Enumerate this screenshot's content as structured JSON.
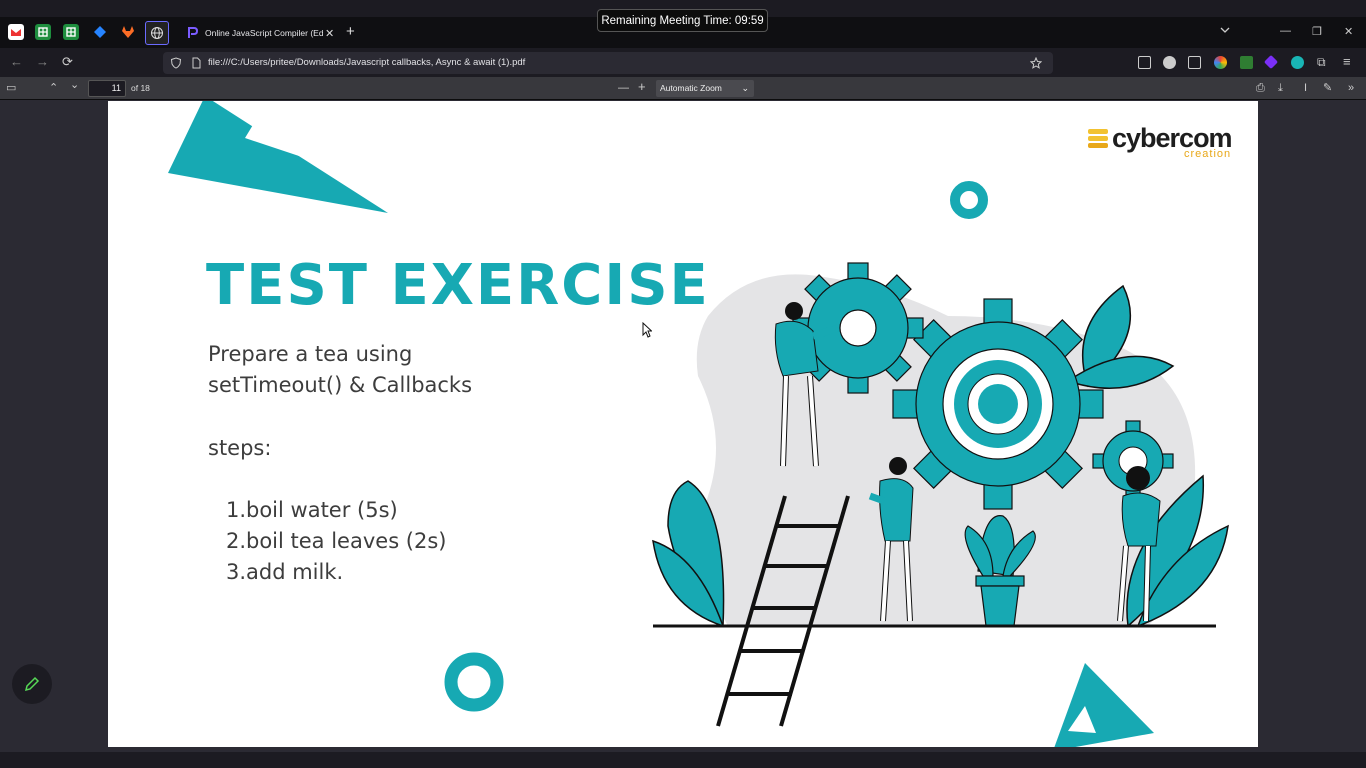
{
  "browser": {
    "tab_title": "Online JavaScript Compiler (Edi",
    "url": "file:///C:/Users/pritee/Downloads/Javascript callbacks, Async & await (1).pdf",
    "meeting_timer": "Remaining Meeting Time: 09:59"
  },
  "pdf_toolbar": {
    "page_number": "11",
    "page_count": "of 18",
    "zoom": "Automatic Zoom"
  },
  "slide": {
    "title": "TEST EXERCISE",
    "prompt_line1": "Prepare a tea using",
    "prompt_line2": "setTimeout() & Callbacks",
    "steps_label": "steps:",
    "steps": [
      {
        "num": "1.",
        "text": "boil water (5s)"
      },
      {
        "num": "2.",
        "text": "boil tea leaves (2s)"
      },
      {
        "num": "3.",
        "text": "add milk."
      }
    ],
    "logo_main": "cybercom",
    "logo_sub": "creation"
  },
  "colors": {
    "accent": "#17a9b3",
    "logo_yellow": "#f2c230",
    "logo_orange": "#e8a81a",
    "illustration_gray": "#e4e4e6"
  }
}
